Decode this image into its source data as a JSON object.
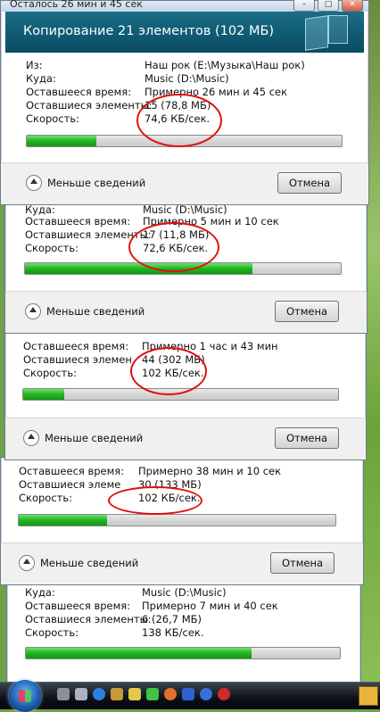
{
  "window_title": "Осталось 26 мин и 45 сек",
  "dialog_title": "Копирование 21 элементов (102 МБ)",
  "labels": {
    "from": "Из:",
    "to": "Куда:",
    "time": "Оставшееся время:",
    "items": "Оставшиеся элементы:",
    "items_cut": "Оставшиеся элеме",
    "items_cut2": "Оставшиеся элемен",
    "items_cut3": "Оставшиеся элементы:",
    "speed": "Скорость:"
  },
  "less_details": "Меньше сведений",
  "cancel": "Отмена",
  "windows": [
    {
      "from": "Наш рок (E:\\Музыка\\Наш рок)",
      "to": "Music (D:\\Music)",
      "time": "Примерно 26 мин и 45 сек",
      "items": "15 (78,8 МБ)",
      "speed": "74,6 КБ/сек.",
      "progress": 0.22
    },
    {
      "to": "Music (D:\\Music)",
      "time": "Примерно 5 мин и 10 сек",
      "items": "17 (11,8 МБ)",
      "speed": "72,6 КБ/сек.",
      "progress": 0.72
    },
    {
      "to": "Music (D:\\Music)",
      "time": "Примерно 1 час и 43 мин",
      "items": "44 (302 МБ)",
      "speed": "102 КБ/сек.",
      "progress": 0.13
    },
    {
      "time": "Примерно 38 мин и 10 сек",
      "items": "30 (133 МБ)",
      "speed": "102 КБ/сек.",
      "progress": 0.28
    },
    {
      "to": "Music (D:\\Music)",
      "time": "Примерно 7 мин и 40 сек",
      "items": "6 (26,7 МБ)",
      "speed": "138 КБ/сек.",
      "progress": 0.72
    }
  ],
  "colors": {
    "header": "#0f5b73",
    "progress": "#22b422",
    "annotation": "#e01010"
  }
}
